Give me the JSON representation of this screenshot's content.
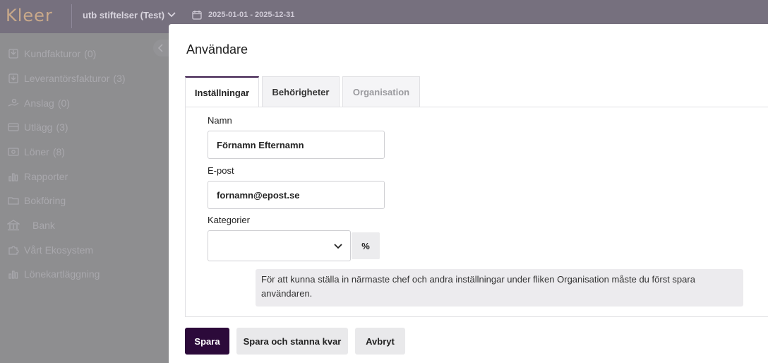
{
  "topbar": {
    "logo": "Kleer",
    "org": "utb stiftelser (Test)",
    "date_range": "2025-01-01 - 2025-12-31"
  },
  "sidebar": {
    "items": [
      {
        "label": "Kundfakturor",
        "count": "(0)",
        "icon": "invoice-in-icon"
      },
      {
        "label": "Leverantörsfakturor",
        "count": "(3)",
        "icon": "invoice-out-icon"
      },
      {
        "label": "Anslag",
        "count": "(0)",
        "icon": "hand-coin-icon"
      },
      {
        "label": "Utlägg",
        "count": "(3)",
        "icon": "card-icon"
      },
      {
        "label": "Löner",
        "count": "(8)",
        "icon": "money-icon"
      },
      {
        "label": "Rapporter",
        "count": "",
        "icon": "bar-chart-icon"
      },
      {
        "label": "Bokföring",
        "count": "",
        "icon": "folder-icon"
      },
      {
        "label": "Bank",
        "count": "",
        "icon": "bank-icon"
      },
      {
        "label": "Vårt Ekosystem",
        "count": "",
        "icon": "puzzle-icon"
      },
      {
        "label": "Lönekartläggning",
        "count": "",
        "icon": "bar-chart-icon"
      }
    ]
  },
  "panel": {
    "title": "Användare",
    "tabs": [
      {
        "label": "Inställningar",
        "state": "active"
      },
      {
        "label": "Behörigheter",
        "state": "inactive"
      },
      {
        "label": "Organisation",
        "state": "disabled"
      }
    ],
    "form": {
      "name_label": "Namn",
      "name_value": "Förnamn Efternamn",
      "email_label": "E-post",
      "email_value": "fornamn@epost.se",
      "category_label": "Kategorier",
      "category_value": "",
      "percent_label": "%",
      "note": "För att kunna ställa in närmaste chef och andra inställningar under fliken Organisation måste du först spara användaren."
    },
    "actions": {
      "save": "Spara",
      "save_stay": "Spara och stanna kvar",
      "cancel": "Avbryt"
    }
  },
  "colors": {
    "topbar": "#76707e",
    "primary": "#2c0a3a",
    "overlay": "#8e8e90"
  }
}
